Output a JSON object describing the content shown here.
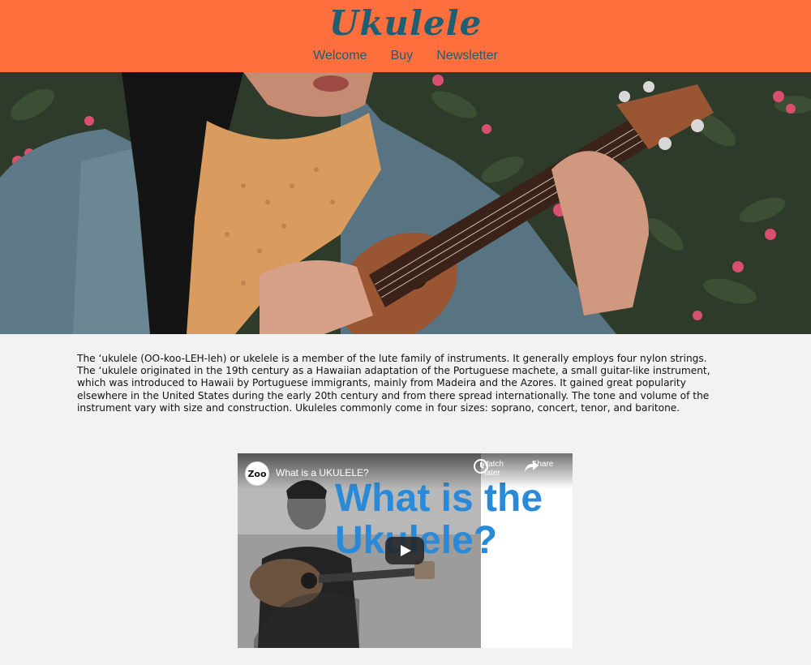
{
  "header": {
    "brand": "Ukulele",
    "nav": [
      "Welcome",
      "Buy",
      "Newsletter"
    ]
  },
  "intro": {
    "text": "The ʻukulele (OO-koo-LEH-leh) or ukelele is a member of the lute family of instruments. It generally employs four nylon strings. The ʻukulele originated in the 19th century as a Hawaiian adaptation of the Portuguese machete, a small guitar-like instrument, which was introduced to Hawaii by Portuguese immigrants, mainly from Madeira and the Azores. It gained great popularity elsewhere in the United States during the early 20th century and from there spread internationally. The tone and volume of the instrument vary with size and construction. Ukuleles commonly come in four sizes: soprano, concert, tenor, and baritone."
  },
  "video": {
    "channel_logo": "Zoo",
    "title": "What is a UKULELE?",
    "watch_later": "Watch later",
    "share": "Share",
    "headline_line1": "What is the",
    "headline_line2": "Ukulele?"
  },
  "colors": {
    "header_bg": "#ff6e3d",
    "brand": "#1e5f74",
    "page_bg": "#f2f2f2",
    "video_headline": "#2a8ad8"
  },
  "icons": {
    "watch_later": "clock-icon",
    "share": "share-arrow-icon",
    "play": "play-icon"
  }
}
